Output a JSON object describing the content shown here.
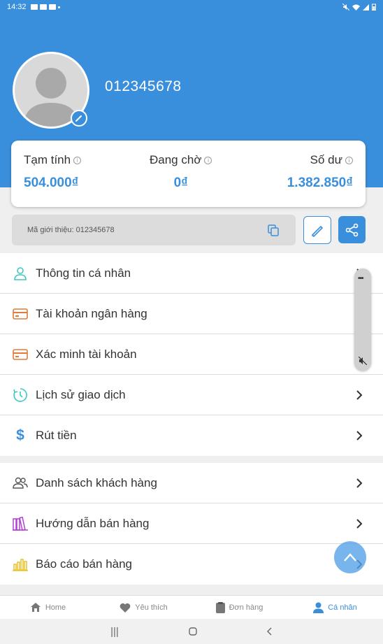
{
  "status_bar": {
    "time": "14:32"
  },
  "profile": {
    "phone": "012345678"
  },
  "stats": [
    {
      "label": "Tạm tính",
      "value": "504.000₫"
    },
    {
      "label": "Đang chờ",
      "value": "0₫"
    },
    {
      "label": "Số dư",
      "value": "1.382.850₫"
    }
  ],
  "referral": {
    "text": "Mã giới thiệu: 012345678"
  },
  "menu_group_1": [
    {
      "label": "Thông tin cá nhân",
      "icon": "person-icon"
    },
    {
      "label": "Tài khoản ngân hàng",
      "icon": "card-icon"
    },
    {
      "label": "Xác minh tài khoản",
      "icon": "card-icon"
    },
    {
      "label": "Lịch sử giao dịch",
      "icon": "history-icon"
    },
    {
      "label": "Rút tiền",
      "icon": "dollar-icon"
    }
  ],
  "menu_group_2": [
    {
      "label": "Danh sách khách hàng",
      "icon": "people-icon"
    },
    {
      "label": "Hướng dẫn bán hàng",
      "icon": "books-icon"
    },
    {
      "label": "Báo cáo bán hàng",
      "icon": "bar-chart-icon"
    }
  ],
  "bottom_nav": [
    {
      "label": "Home",
      "icon": "home-icon"
    },
    {
      "label": "Yêu thích",
      "icon": "heart-icon"
    },
    {
      "label": "Đơn hàng",
      "icon": "order-icon"
    },
    {
      "label": "Cá nhân",
      "icon": "person-icon",
      "active": true
    }
  ],
  "colors": {
    "primary": "#3a8fdc",
    "orange": "#e07b39",
    "teal": "#3cc9c0",
    "purple": "#b13fd6",
    "yellow": "#e8c22a"
  }
}
